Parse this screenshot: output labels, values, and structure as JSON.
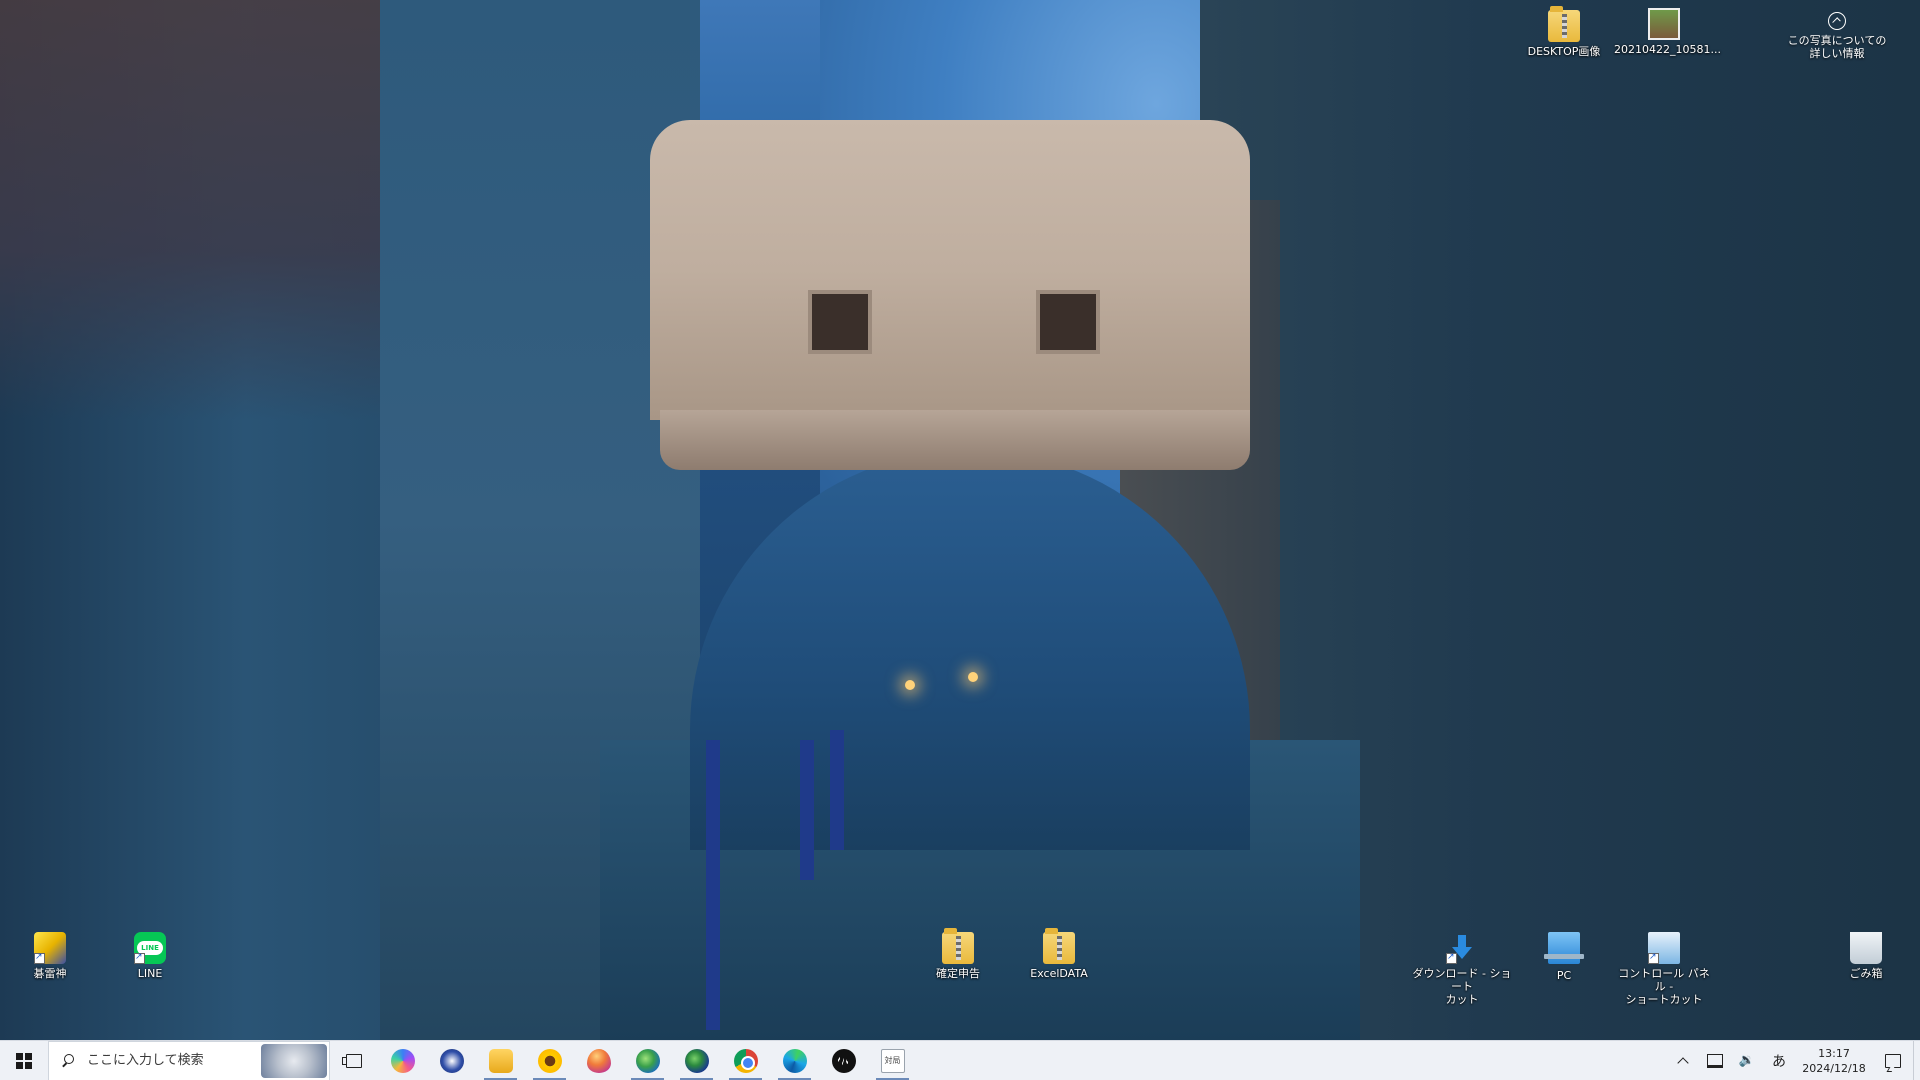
{
  "desktop": {
    "spotlight": {
      "label": "この写真についての\n詳しい情報"
    },
    "icons_top": [
      {
        "id": "desktop-images",
        "label": "DESKTOP画像",
        "icon": "zip-folder-icon"
      },
      {
        "id": "photo-file",
        "label": "20210422_10581...",
        "icon": "photo-file-icon"
      }
    ],
    "icons_bottom": [
      {
        "id": "go-raijin",
        "label": "碁雷神",
        "icon": "go-raijin-app-icon"
      },
      {
        "id": "line",
        "label": "LINE",
        "icon": "line-app-icon"
      },
      {
        "id": "kakutei",
        "label": "確定申告",
        "icon": "zip-folder-icon"
      },
      {
        "id": "exceldata",
        "label": "ExcelDATA",
        "icon": "zip-folder-icon"
      },
      {
        "id": "download-shortcut",
        "label": "ダウンロード - ショート\nカット",
        "icon": "download-shortcut-icon"
      },
      {
        "id": "pc",
        "label": "PC",
        "icon": "pc-icon"
      },
      {
        "id": "control-panel",
        "label": "コントロール パネル -\nショートカット",
        "icon": "control-panel-icon"
      },
      {
        "id": "recycle-bin",
        "label": "ごみ箱",
        "icon": "recycle-bin-icon"
      }
    ]
  },
  "taskbar": {
    "search_placeholder": "ここに入力して検索",
    "apps": [
      {
        "name": "copilot",
        "icon": "copilot-icon",
        "running": false
      },
      {
        "name": "ntt-app",
        "icon": "ntt-app-icon",
        "running": false
      },
      {
        "name": "file-explorer",
        "icon": "file-explorer-icon",
        "running": true
      },
      {
        "name": "sunflower-app",
        "icon": "sunflower-app-icon",
        "running": true
      },
      {
        "name": "drop-app",
        "icon": "drop-app-icon",
        "running": false
      },
      {
        "name": "globe-app",
        "icon": "globe-app-icon",
        "running": true
      },
      {
        "name": "earth-app",
        "icon": "earth-app-icon",
        "running": true
      },
      {
        "name": "chrome",
        "icon": "chrome-icon",
        "running": true
      },
      {
        "name": "edge",
        "icon": "edge-icon",
        "running": true
      },
      {
        "name": "audio-app",
        "icon": "audio-app-icon",
        "running": false
      },
      {
        "name": "taikyoku",
        "icon": "taikyoku-icon",
        "label": "対局",
        "running": true
      }
    ],
    "tray": {
      "ime": "あ",
      "time": "13:17",
      "date": "2024/12/18"
    }
  }
}
